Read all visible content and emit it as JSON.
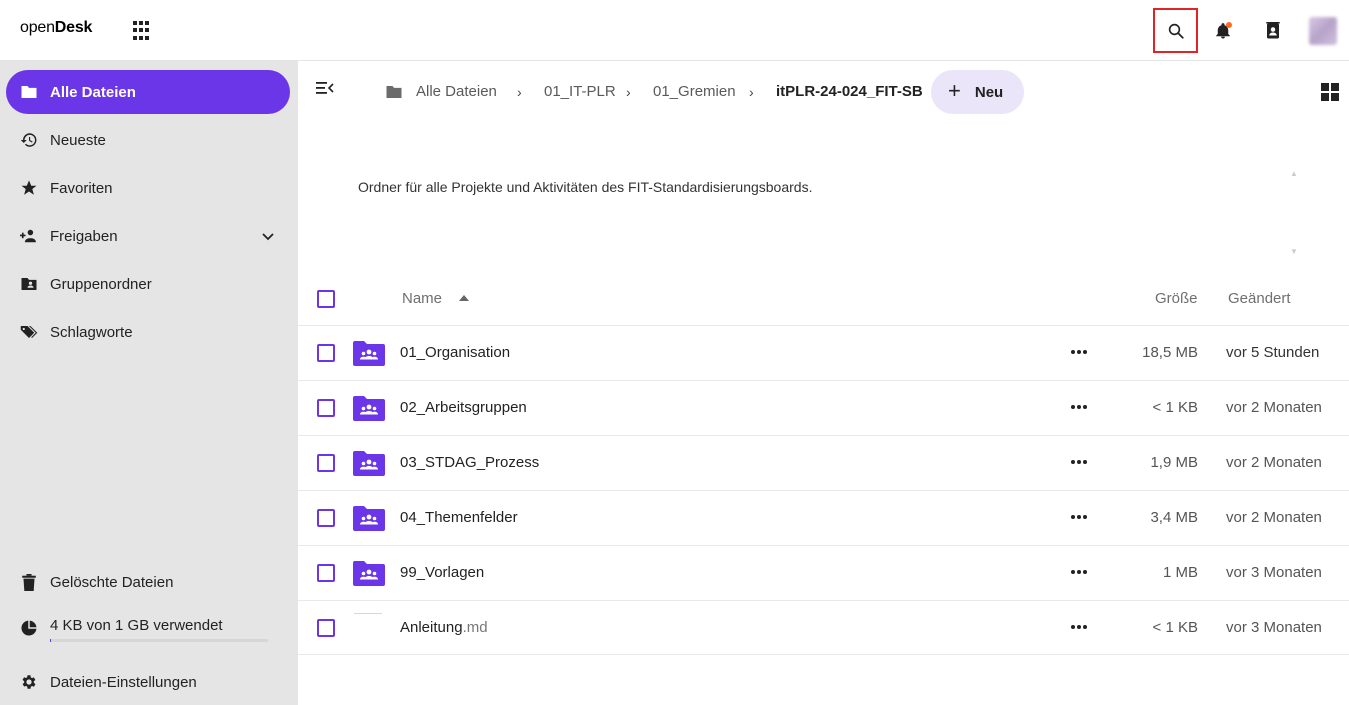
{
  "header": {
    "logo_light": "open",
    "logo_bold": "Desk",
    "accent": "#6b35e8",
    "notification_dot_color": "#ff6a1f",
    "icons": [
      "apps-grid-icon",
      "search-icon",
      "bell-icon",
      "contacts-icon"
    ]
  },
  "sidebar": {
    "items": [
      {
        "label": "Alle Dateien",
        "icon": "folder-icon",
        "active": true
      },
      {
        "label": "Neueste",
        "icon": "history-icon"
      },
      {
        "label": "Favoriten",
        "icon": "star-icon"
      },
      {
        "label": "Freigaben",
        "icon": "share-user-icon"
      },
      {
        "label": "Gruppenordner",
        "icon": "group-folder-icon"
      },
      {
        "label": "Schlagworte",
        "icon": "tag-icon"
      }
    ],
    "bottom": [
      {
        "label": "Gelöschte Dateien",
        "icon": "trash-icon"
      },
      {
        "label": "4 KB von 1 GB verwendet",
        "icon": "pie-chart-icon"
      },
      {
        "label": "Dateien-Einstellungen",
        "icon": "gear-icon"
      }
    ],
    "quota_used_fraction": 0.004
  },
  "breadcrumb": {
    "items": [
      "Alle Dateien",
      "01_IT-PLR",
      "01_Gremien",
      "itPLR-24-024_FIT-SB"
    ],
    "new_label": "Neu"
  },
  "description": "Ordner für alle Projekte und Aktivitäten des FIT-Standardisierungsboards.",
  "table": {
    "columns": {
      "name": "Name",
      "size": "Größe",
      "modified": "Geändert"
    },
    "rows": [
      {
        "name": "01_Organisation",
        "ext": "",
        "type": "group-folder",
        "size": "18,5 MB",
        "modified": "vor 5 Stunden"
      },
      {
        "name": "02_Arbeitsgruppen",
        "ext": "",
        "type": "group-folder",
        "size": "< 1 KB",
        "modified": "vor 2 Monaten"
      },
      {
        "name": "03_STDAG_Prozess",
        "ext": "",
        "type": "group-folder",
        "size": "1,9 MB",
        "modified": "vor 2 Monaten"
      },
      {
        "name": "04_Themenfelder",
        "ext": "",
        "type": "group-folder",
        "size": "3,4 MB",
        "modified": "vor 2 Monaten"
      },
      {
        "name": "99_Vorlagen",
        "ext": "",
        "type": "group-folder",
        "size": "1 MB",
        "modified": "vor 3 Monaten"
      },
      {
        "name": "Anleitung",
        "ext": ".md",
        "type": "file",
        "size": "< 1 KB",
        "modified": "vor 3 Monaten"
      }
    ]
  }
}
